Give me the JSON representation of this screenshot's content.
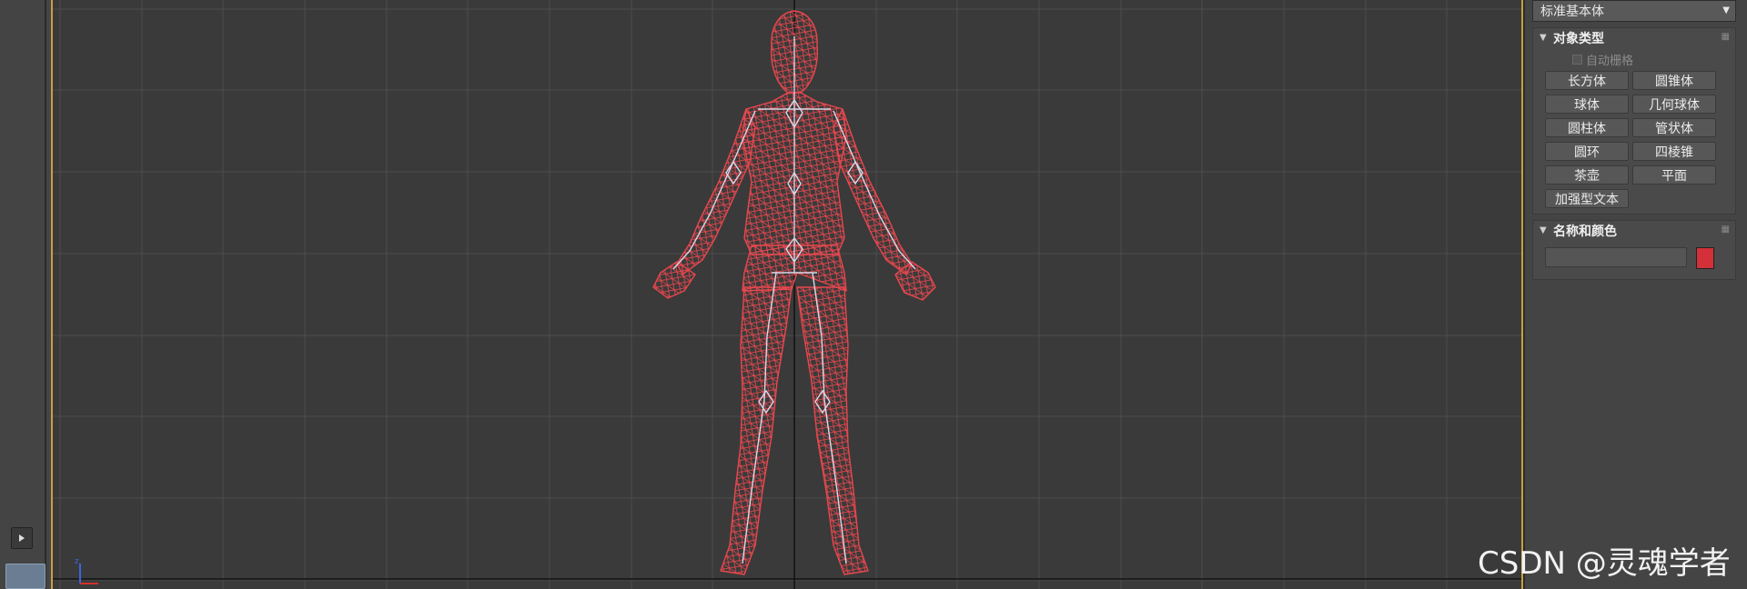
{
  "primitive_dropdown": {
    "selected": "标准基本体"
  },
  "object_type": {
    "title": "对象类型",
    "autogrid_label": "自动栅格",
    "buttons": [
      "长方体",
      "圆锥体",
      "球体",
      "几何球体",
      "圆柱体",
      "管状体",
      "圆环",
      "四棱锥",
      "茶壶",
      "平面",
      "加强型文本"
    ]
  },
  "name_color": {
    "title": "名称和颜色",
    "name_value": "",
    "color": "#d3303a"
  },
  "viewport": {
    "background": "#3a3a3a",
    "wireframe_color": "#e8474e",
    "bones_color": "#d8d8e8",
    "frame_color": "#c8a040"
  },
  "watermark": "CSDN @灵魂学者"
}
